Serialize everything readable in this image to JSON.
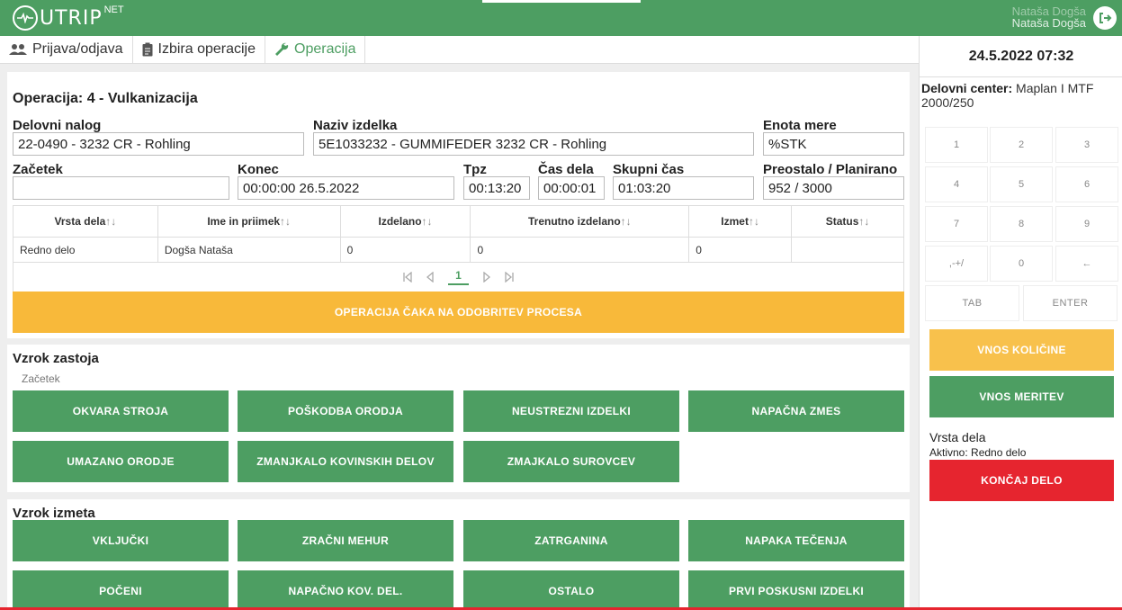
{
  "header": {
    "logo_text": "UTRIP",
    "logo_sup": "NET",
    "user_line1": "Nataša Dogša",
    "user_line2": "Nataša Dogša"
  },
  "nav": {
    "tab_login": "Prijava/odjava",
    "tab_select": "Izbira operacije",
    "tab_operation": "Operacija"
  },
  "operation": {
    "title": "Operacija: 4 - Vulkanizacija",
    "labels": {
      "work_order": "Delovni nalog",
      "product": "Naziv izdelka",
      "unit": "Enota mere",
      "start": "Začetek",
      "end": "Konec",
      "tpz": "Tpz",
      "work_time": "Čas dela",
      "total_time": "Skupni čas",
      "remaining": "Preostalo / Planirano"
    },
    "values": {
      "work_order": "22-0490 - 3232 CR - Rohling",
      "product": "5E1033232 - GUMMIFEDER 3232 CR - Rohling",
      "unit": "%STK",
      "start": "",
      "end": "00:00:00 26.5.2022",
      "tpz": "00:13:20",
      "work_time": "00:00:01",
      "total_time": "01:03:20",
      "remaining": "952 / 3000"
    }
  },
  "table": {
    "sort_icon": "↑↓",
    "columns": [
      "Vrsta dela",
      "Ime in priimek",
      "Izdelano",
      "Trenutno izdelano",
      "Izmet",
      "Status"
    ],
    "rows": [
      [
        "Redno delo",
        "Dogša Nataša",
        "0",
        "0",
        "0",
        ""
      ]
    ]
  },
  "pager": {
    "current": "1"
  },
  "warning": "OPERACIJA ČAKA NA ODOBRITEV PROCESA",
  "downtime": {
    "title": "Vzrok zastoja",
    "subtitle": "Začetek",
    "buttons": [
      "OKVARA STROJA",
      "POŠKODBA ORODJA",
      "NEUSTREZNI IZDELKI",
      "NAPAČNA ZMES",
      "UMAZANO ORODJE",
      "ZMANJKALO KOVINSKIH DELOV",
      "ZMAJKALO SUROVCEV"
    ]
  },
  "scrap": {
    "title": "Vzrok izmeta",
    "buttons": [
      "VKLJUČKI",
      "ZRAČNI MEHUR",
      "ZATRGANINA",
      "NAPAKA TEČENJA",
      "POČENI",
      "NAPAČNO KOV. DEL.",
      "OSTALO",
      "PRVI POSKUSNI IZDELKI"
    ]
  },
  "right": {
    "datetime": "24.5.2022 07:32",
    "work_center_label": "Delovni center:",
    "work_center_value": "Maplan I MTF 2000/250",
    "keys": [
      "1",
      "2",
      "3",
      "4",
      "5",
      "6",
      "7",
      "8",
      "9",
      ",-+/",
      "0",
      "←"
    ],
    "tab_key": "TAB",
    "enter_key": "ENTER",
    "btn_quantity": "VNOS KOLIČINE",
    "btn_measure": "VNOS MERITEV",
    "work_type_label": "Vrsta dela",
    "active_label": "Aktivno:",
    "active_value": "Redno delo",
    "btn_finish": "KONČAJ DELO"
  },
  "colors": {
    "brand_green": "#4d9e62",
    "warning_yellow": "#f8b93a",
    "danger_red": "#e6252f"
  }
}
